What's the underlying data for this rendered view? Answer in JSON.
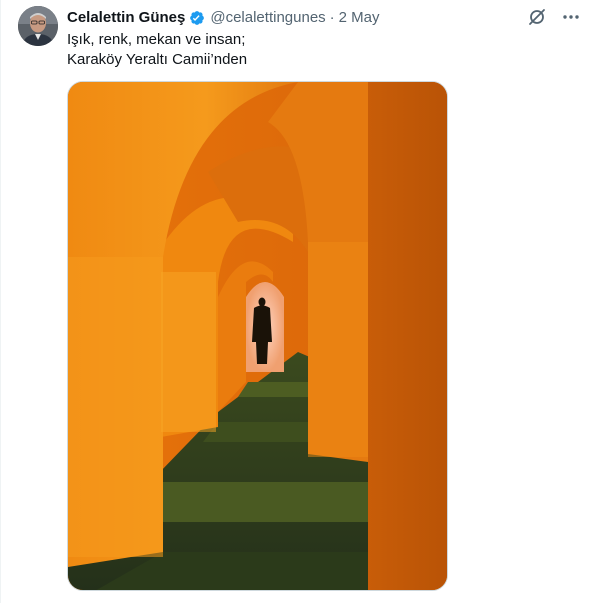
{
  "author": {
    "display_name": "Celalettin Güneş",
    "handle": "@celalettingunes",
    "separator": "·",
    "date": "2 May",
    "verified": true,
    "verified_color": "#1d9bf0"
  },
  "tweet": {
    "lines": [
      "Işık, renk, mekan ve insan;",
      "Karaköy Yeraltı Camii’nden"
    ]
  },
  "icons": {
    "grok": "grok-icon",
    "more": "more-icon",
    "verified": "verified-badge-icon"
  },
  "colors": {
    "text_primary": "#0f1419",
    "text_secondary": "#536471",
    "accent": "#1d9bf0"
  }
}
